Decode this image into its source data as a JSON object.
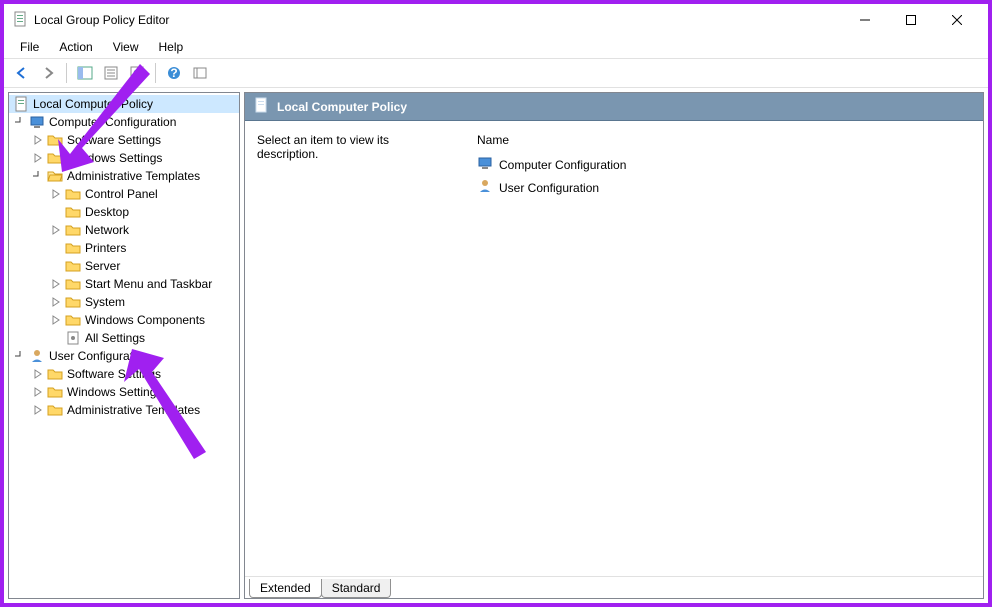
{
  "window": {
    "title": "Local Group Policy Editor"
  },
  "menubar": {
    "file": "File",
    "action": "Action",
    "view": "View",
    "help": "Help"
  },
  "tree": {
    "root": {
      "label": "Local Computer Policy",
      "selected": true
    },
    "cc": {
      "label": "Computer Configuration",
      "expanded": true
    },
    "cc_sw": {
      "label": "Software Settings"
    },
    "cc_win": {
      "label": "Windows Settings"
    },
    "cc_at": {
      "label": "Administrative Templates",
      "expanded": true
    },
    "cc_at_cp": {
      "label": "Control Panel"
    },
    "cc_at_desk": {
      "label": "Desktop"
    },
    "cc_at_net": {
      "label": "Network"
    },
    "cc_at_print": {
      "label": "Printers"
    },
    "cc_at_srv": {
      "label": "Server"
    },
    "cc_at_smt": {
      "label": "Start Menu and Taskbar"
    },
    "cc_at_sys": {
      "label": "System"
    },
    "cc_at_wc": {
      "label": "Windows Components"
    },
    "cc_at_all": {
      "label": "All Settings"
    },
    "uc": {
      "label": "User Configuration",
      "expanded": true
    },
    "uc_sw": {
      "label": "Software Settings"
    },
    "uc_win": {
      "label": "Windows Settings"
    },
    "uc_at": {
      "label": "Administrative Templates"
    }
  },
  "detail": {
    "header": "Local Computer Policy",
    "description_prompt": "Select an item to view its description.",
    "name_header": "Name",
    "items": {
      "cc": "Computer Configuration",
      "uc": "User Configuration"
    }
  },
  "tabs": {
    "extended": "Extended",
    "standard": "Standard"
  }
}
